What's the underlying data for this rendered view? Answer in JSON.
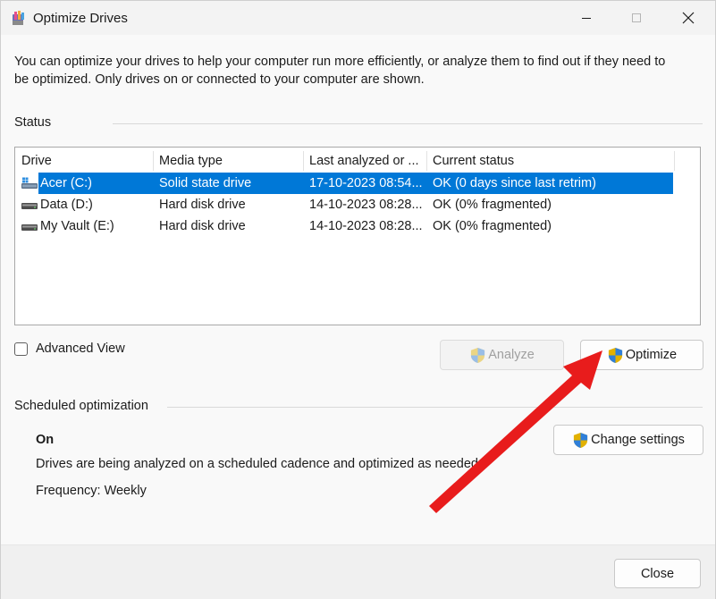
{
  "window": {
    "title": "Optimize Drives",
    "icon": "optimize-drives-app-icon"
  },
  "intro_text": "You can optimize your drives to help your computer run more efficiently, or analyze them to find out if they need to be optimized. Only drives on or connected to your computer are shown.",
  "status": {
    "label": "Status",
    "columns": [
      "Drive",
      "Media type",
      "Last analyzed or ...",
      "Current status"
    ],
    "rows": [
      {
        "drive": "Acer (C:)",
        "media_type": "Solid state drive",
        "last_analyzed": "17-10-2023 08:54...",
        "current_status": "OK (0 days since last retrim)",
        "icon": "windows-system-drive-icon",
        "selected": true
      },
      {
        "drive": "Data (D:)",
        "media_type": "Hard disk drive",
        "last_analyzed": "14-10-2023 08:28...",
        "current_status": "OK (0% fragmented)",
        "icon": "hard-drive-icon",
        "selected": false
      },
      {
        "drive": "My Vault (E:)",
        "media_type": "Hard disk drive",
        "last_analyzed": "14-10-2023 08:28...",
        "current_status": "OK (0% fragmented)",
        "icon": "hard-drive-icon",
        "selected": false
      }
    ]
  },
  "advanced_view": {
    "label": "Advanced View",
    "checked": false
  },
  "buttons": {
    "analyze": "Analyze",
    "optimize": "Optimize",
    "change_settings": "Change settings",
    "close": "Close"
  },
  "scheduled": {
    "label": "Scheduled optimization",
    "state": "On",
    "description": "Drives are being analyzed on a scheduled cadence and optimized as needed.",
    "frequency": "Frequency: Weekly"
  },
  "colors": {
    "selection": "#0078d7",
    "annotation_arrow": "#e81c1c"
  }
}
